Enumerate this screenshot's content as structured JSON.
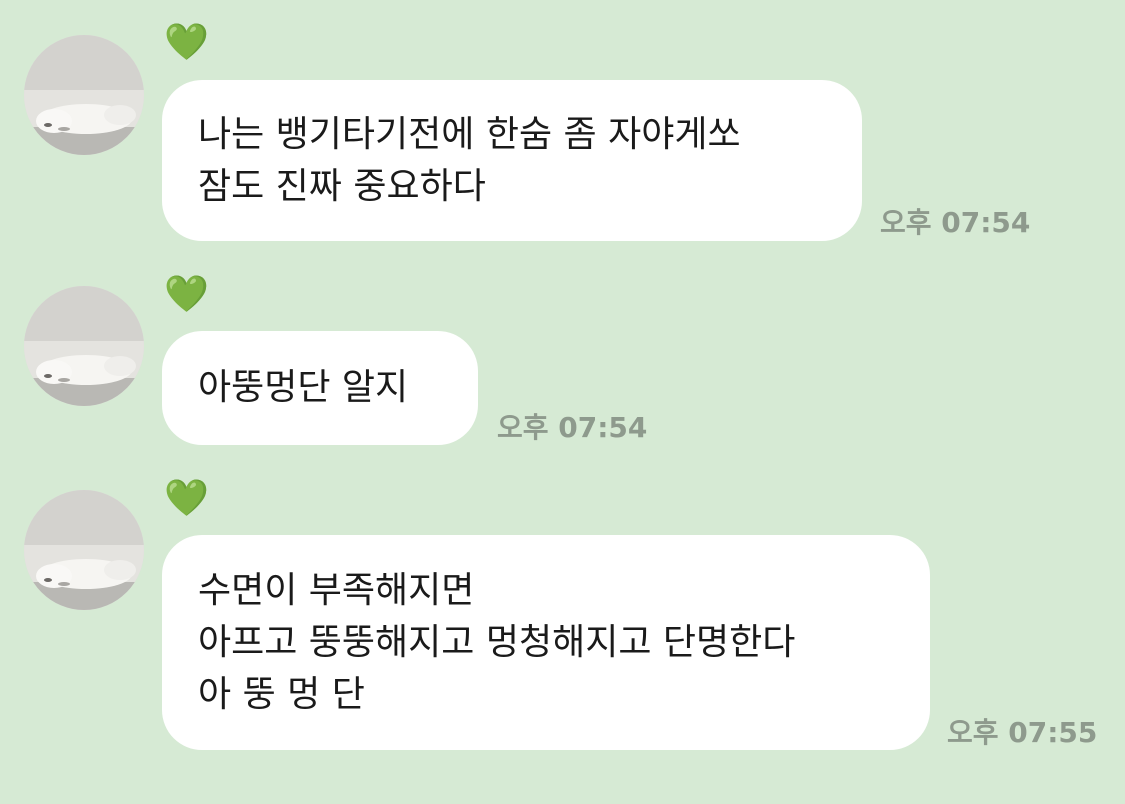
{
  "messages": [
    {
      "sender_name": "💚",
      "lines": [
        "나는 뱅기타기전에 한숨 좀 자야게쏘",
        "잠도 진짜 중요하다"
      ],
      "time": "오후 07:54"
    },
    {
      "sender_name": "💚",
      "lines": [
        "아뚱멍단 알지"
      ],
      "time": "오후 07:54"
    },
    {
      "sender_name": "💚",
      "lines": [
        "수면이 부족해지면",
        "아프고 뚱뚱해지고 멍청해지고 단명한다",
        "아 뚱 멍 단"
      ],
      "time": "오후 07:55"
    }
  ],
  "colors": {
    "background": "#d6ead4",
    "bubble": "#ffffff",
    "timestamp": "#8e9a8d",
    "heart": "#55c94f"
  }
}
